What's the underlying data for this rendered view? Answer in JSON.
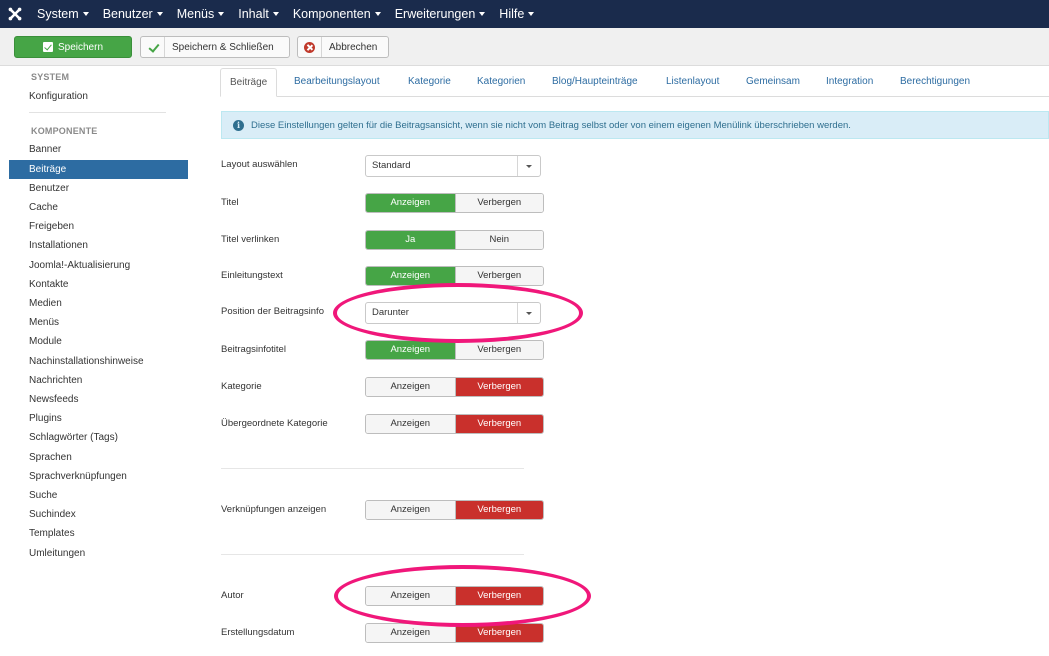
{
  "navbar": {
    "logo_icon": "joomla-logo-icon",
    "menu": [
      {
        "label": "System"
      },
      {
        "label": "Benutzer"
      },
      {
        "label": "Menüs"
      },
      {
        "label": "Inhalt"
      },
      {
        "label": "Komponenten"
      },
      {
        "label": "Erweiterungen"
      },
      {
        "label": "Hilfe"
      }
    ]
  },
  "toolbar": {
    "save_label": "Speichern",
    "save_close_label": "Speichern & Schließen",
    "cancel_label": "Abbrechen"
  },
  "sidebar": {
    "system_header": "SYSTEM",
    "system_items": [
      {
        "label": "Konfiguration"
      }
    ],
    "component_header": "KOMPONENTE",
    "component_items": [
      {
        "label": "Banner"
      },
      {
        "label": "Beiträge",
        "active": true
      },
      {
        "label": "Benutzer"
      },
      {
        "label": "Cache"
      },
      {
        "label": "Freigeben"
      },
      {
        "label": "Installationen"
      },
      {
        "label": "Joomla!-Aktualisierung"
      },
      {
        "label": "Kontakte"
      },
      {
        "label": "Medien"
      },
      {
        "label": "Menüs"
      },
      {
        "label": "Module"
      },
      {
        "label": "Nachinstallationshinweise"
      },
      {
        "label": "Nachrichten"
      },
      {
        "label": "Newsfeeds"
      },
      {
        "label": "Plugins"
      },
      {
        "label": "Schlagwörter (Tags)"
      },
      {
        "label": "Sprachen"
      },
      {
        "label": "Sprachverknüpfungen"
      },
      {
        "label": "Suche"
      },
      {
        "label": "Suchindex"
      },
      {
        "label": "Templates"
      },
      {
        "label": "Umleitungen"
      }
    ]
  },
  "tabs": [
    {
      "label": "Beiträge",
      "active": true
    },
    {
      "label": "Bearbeitungslayout"
    },
    {
      "label": "Kategorie"
    },
    {
      "label": "Kategorien"
    },
    {
      "label": "Blog/Haupteinträge"
    },
    {
      "label": "Listenlayout"
    },
    {
      "label": "Gemeinsam"
    },
    {
      "label": "Integration"
    },
    {
      "label": "Berechtigungen"
    }
  ],
  "info_alert": "Diese Einstellungen gelten für die Beitragsansicht, wenn sie nicht vom Beitrag selbst oder von einem eigenen Menülink überschrieben werden.",
  "form": {
    "layout": {
      "label": "Layout auswählen",
      "value": "Standard"
    },
    "titel": {
      "label": "Titel",
      "on": "Anzeigen",
      "off": "Verbergen",
      "selected": "on"
    },
    "titel_verlinken": {
      "label": "Titel verlinken",
      "on": "Ja",
      "off": "Nein",
      "selected": "on"
    },
    "einleitungstext": {
      "label": "Einleitungstext",
      "on": "Anzeigen",
      "off": "Verbergen",
      "selected": "on"
    },
    "position": {
      "label": "Position der Beitragsinfo",
      "value": "Darunter"
    },
    "beitragsinfotitel": {
      "label": "Beitragsinfotitel",
      "on": "Anzeigen",
      "off": "Verbergen",
      "selected": "on"
    },
    "kategorie": {
      "label": "Kategorie",
      "on": "Anzeigen",
      "off": "Verbergen",
      "selected": "off"
    },
    "uebergeordnete_kategorie": {
      "label": "Übergeordnete Kategorie",
      "on": "Anzeigen",
      "off": "Verbergen",
      "selected": "off"
    },
    "verknuepfungen": {
      "label": "Verknüpfungen anzeigen",
      "on": "Anzeigen",
      "off": "Verbergen",
      "selected": "off"
    },
    "autor": {
      "label": "Autor",
      "on": "Anzeigen",
      "off": "Verbergen",
      "selected": "off"
    },
    "erstellungsdatum": {
      "label": "Erstellungsdatum",
      "on": "Anzeigen",
      "off": "Verbergen",
      "selected": "off"
    }
  },
  "colors": {
    "navbar_bg": "#1a2b4c",
    "save_green": "#46a546",
    "active_blue": "#2d6ca2",
    "hide_red": "#c9302c",
    "annotation_pink": "#f0177a"
  }
}
